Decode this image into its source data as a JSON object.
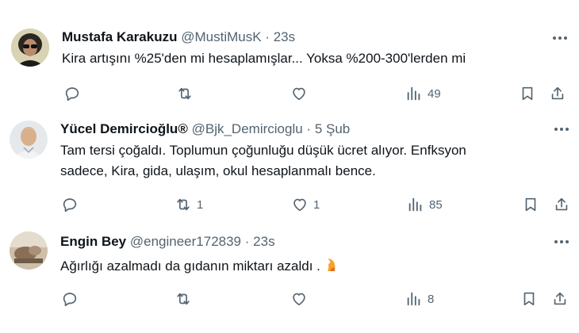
{
  "tweets": [
    {
      "name": "Mustafa Karakuzu",
      "handle": "@MustiMusK",
      "separator": "·",
      "time": "23s",
      "lines": [
        "Kira artışını %25'den mi hesaplamışlar... Yoksa %200-300'lerden mi"
      ],
      "reply_count": "",
      "retweet_count": "",
      "like_count": "",
      "view_count": "49"
    },
    {
      "name": "Yücel Demircioğlu®",
      "handle": "@Bjk_Demircioglu",
      "separator": "·",
      "time": "5 Şub",
      "lines": [
        "Tam tersi çoğaldı. Toplumun çoğunluğu düşük ücret alıyor. Enfksyon",
        "sadece, Kira, gida, ulaşım, okul hesaplanmalı bence."
      ],
      "reply_count": "",
      "retweet_count": "1",
      "like_count": "1",
      "view_count": "85"
    },
    {
      "name": "Engin Bey",
      "handle": "@engineer172839",
      "separator": "·",
      "time": "23s",
      "lines": [
        "Ağırlığı azalmadı da gıdanın miktarı azaldı ."
      ],
      "reply_count": "",
      "retweet_count": "",
      "like_count": "",
      "view_count": "8"
    }
  ],
  "icons": {
    "reply": "reply-icon",
    "retweet": "retweet-icon",
    "like": "heart-icon",
    "views": "views-icon",
    "bookmark": "bookmark-icon",
    "share": "share-icon",
    "more": "more-icon"
  },
  "colors": {
    "text": "#0f1419",
    "secondary": "#536471",
    "background": "#ffffff"
  }
}
